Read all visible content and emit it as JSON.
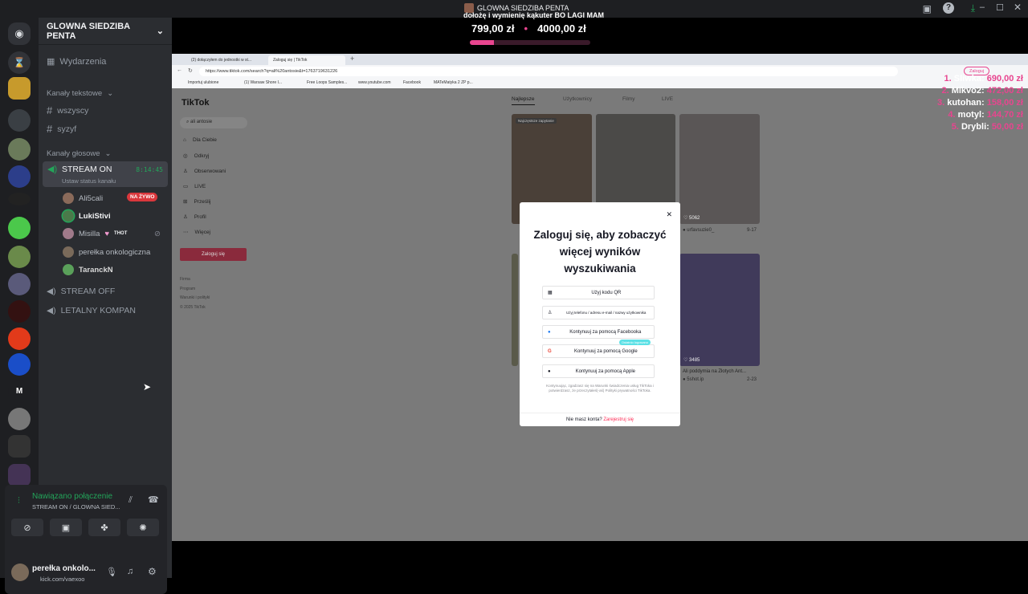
{
  "window": {
    "title_line1": "GLOWNA SIEDZIBA PENTA",
    "title_line2": "dołożę i wymienię kąkuter BO LAGI MAM",
    "goal_current": "799,00 zł",
    "goal_target": "4000,00 zł",
    "goal_progress": 0.2
  },
  "server": {
    "name": "GLOWNA SIEDZIBA PENTA"
  },
  "channels": {
    "events": "Wydarzenia",
    "text_category": "Kanały tekstowe",
    "text": [
      "wszyscy",
      "syzyf"
    ],
    "voice_category": "Kanały głosowe",
    "live_channel": {
      "name": "STREAM ON",
      "time": "8:14:45",
      "status": "Ustaw status kanału"
    },
    "members": [
      {
        "name": "Ali5cali",
        "badge": "NA ŻYWO"
      },
      {
        "name": "LukiStivi"
      },
      {
        "name": "Misilla",
        "tag": "THOT"
      },
      {
        "name": "perełka onkologiczna"
      },
      {
        "name": "TaranckN"
      }
    ],
    "voice_other": [
      "STREAM OFF",
      "LETALNY KOMPAN"
    ]
  },
  "voice_panel": {
    "status": "Nawiązano połączenie",
    "channel": "STREAM ON / GLOWNA SIED...",
    "user": "perełka onkolo...",
    "sub": "kick.com/vaexoo"
  },
  "browser": {
    "tabs": [
      "(2) dołączyłem do jednostki w st...",
      "Zaloguj się | TikTok"
    ],
    "url": "https://www.tiktok.com/search?q=ali%20antosie&t=1763719631226",
    "bookmarks": [
      "Importuj ulubione",
      "(1) Warsaw Shore I...",
      "Free Loops Samples...",
      "www.youtube.com",
      "Facebook",
      "MATeMatyka 2 ZP p..."
    ],
    "login_btn": "Zaloguj"
  },
  "tiktok": {
    "logo": "TikTok",
    "search": "ali antosie",
    "nav": [
      "Dla Ciebie",
      "Odkryj",
      "Obserwowani",
      "LIVE",
      "Prześlij",
      "Profil",
      "Więcej"
    ],
    "login": "Zaloguj się",
    "footer": [
      "Firma",
      "Program",
      "Warunki i polityki",
      "© 2025 TikTok"
    ],
    "tabs": [
      "Najlepsze",
      "Użytkownicy",
      "Filmy",
      "LIVE"
    ],
    "videos": [
      {
        "views": "5062",
        "user": "urfavsuzie0_",
        "time": "9-17"
      },
      {
        "views": "3485",
        "caption": "Ali poddymia na Złotych Ant...",
        "user": "5shot.ip",
        "time": "2-23"
      }
    ],
    "thumb_label": "Najczęstsze zapytanie"
  },
  "modal": {
    "title": "Zaloguj się, aby zobaczyć więcej wyników wyszukiwania",
    "options": [
      "Użyj kodu QR",
      "Użyj telefonu / adresu e-mail / nazwy użytkownika",
      "Kontynuuj za pomocą Facebooka",
      "Kontynuuj za pomocą Google",
      "Kontynuuj za pomocą Apple"
    ],
    "last_used": "Ostatnio logowano",
    "legal": "Kontynuując, zgadzasz się na Warunki świadczenia usług TikToka i potwierdzasz, że przeczytałeś(-aś) Polityki prywatności TikToka.",
    "signup_q": "Nie masz konta?",
    "signup": "Zarejestruj się"
  },
  "leaderboard": [
    {
      "rank": "1.",
      "name": "Sliwka:",
      "amount": "690,00 zł"
    },
    {
      "rank": "2.",
      "name": "Mikvo2:",
      "amount": "472,00 zł"
    },
    {
      "rank": "3.",
      "name": "kutohan:",
      "amount": "158,00 zł"
    },
    {
      "rank": "4.",
      "name": "motyl:",
      "amount": "144,70 zł"
    },
    {
      "rank": "5.",
      "name": "Drybli:",
      "amount": "50,00 zł"
    }
  ]
}
